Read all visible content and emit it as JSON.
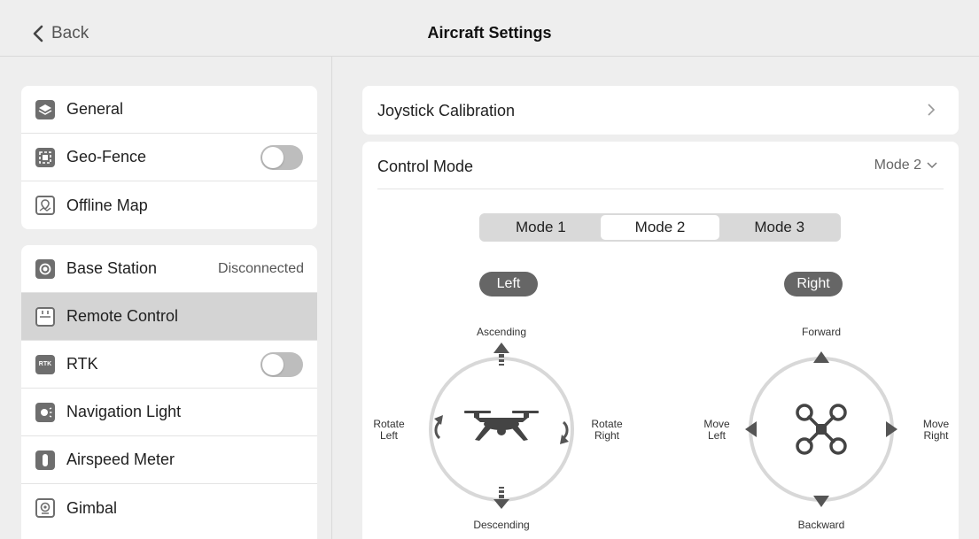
{
  "header": {
    "back_label": "Back",
    "title": "Aircraft Settings"
  },
  "sidebar": {
    "group1": [
      {
        "label": "General",
        "icon": "layers-icon"
      },
      {
        "label": "Geo-Fence",
        "icon": "geofence-icon",
        "toggle": "off"
      },
      {
        "label": "Offline Map",
        "icon": "map-icon"
      }
    ],
    "group2": [
      {
        "label": "Base Station",
        "icon": "base-station-icon",
        "status": "Disconnected"
      },
      {
        "label": "Remote Control",
        "icon": "remote-control-icon",
        "active": true
      },
      {
        "label": "RTK",
        "icon": "rtk-icon",
        "icon_text": "RTK",
        "toggle": "off"
      },
      {
        "label": "Navigation Light",
        "icon": "navigation-light-icon"
      },
      {
        "label": "Airspeed Meter",
        "icon": "airspeed-meter-icon"
      },
      {
        "label": "Gimbal",
        "icon": "gimbal-icon"
      }
    ]
  },
  "main": {
    "joystick_calibration": "Joystick Calibration",
    "control_mode": {
      "label": "Control Mode",
      "value": "Mode 2",
      "modes": [
        "Mode 1",
        "Mode 2",
        "Mode 3"
      ],
      "selected": "Mode 2"
    },
    "left_stick": {
      "title": "Left",
      "up": "Ascending",
      "down": "Descending",
      "left": [
        "Rotate",
        "Left"
      ],
      "right": [
        "Rotate",
        "Right"
      ]
    },
    "right_stick": {
      "title": "Right",
      "up": "Forward",
      "down": "Backward",
      "left": [
        "Move",
        "Left"
      ],
      "right": [
        "Move",
        "Right"
      ]
    }
  },
  "colors": {
    "background": "#eeeeee",
    "card": "#ffffff",
    "active_row": "#d4d4d4",
    "icon_gray": "#6e6e6e",
    "toggle_off": "#bdbdbd",
    "diagram_circle": "#d8d8d8",
    "arrow": "#555555"
  }
}
